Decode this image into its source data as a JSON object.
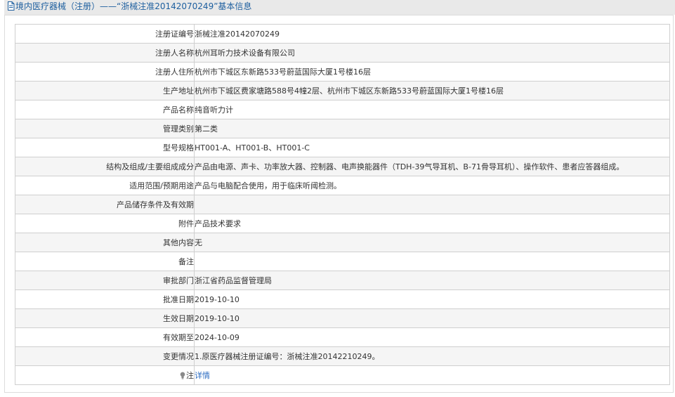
{
  "header": {
    "title": "境内医疗器械（注册）——“浙械注准20142070249”基本信息"
  },
  "rows": [
    {
      "label": "注册证编号",
      "value": "浙械注准20142070249"
    },
    {
      "label": "注册人名称",
      "value": "杭州耳听力技术设备有限公司"
    },
    {
      "label": "注册人住所",
      "value": "杭州市下城区东新路533号蔚蓝国际大厦1号楼16层"
    },
    {
      "label": "生产地址",
      "value": "杭州市下城区费家塘路588号4幢2层、杭州市下城区东新路533号蔚蓝国际大厦1号楼16层"
    },
    {
      "label": "产品名称",
      "value": "纯音听力计"
    },
    {
      "label": "管理类别",
      "value": "第二类"
    },
    {
      "label": "型号规格",
      "value": "HT001-A、HT001-B、HT001-C"
    },
    {
      "label": "结构及组成/主要组成成分",
      "value": "产品由电源、声卡、功率放大器、控制器、电声换能器件（TDH-39气导耳机、B-71骨导耳机）、操作软件、患者应答器组成。"
    },
    {
      "label": "适用范围/预期用途",
      "value": "产品与电脑配合使用，用于临床听阈检测。"
    },
    {
      "label": "产品储存条件及有效期",
      "value": ""
    },
    {
      "label": "附件",
      "value": "产品技术要求"
    },
    {
      "label": "其他内容",
      "value": "无"
    },
    {
      "label": "备注",
      "value": ""
    },
    {
      "label": "审批部门",
      "value": "浙江省药品监督管理局"
    },
    {
      "label": "批准日期",
      "value": "2019-10-10"
    },
    {
      "label": "生效日期",
      "value": "2019-10-10"
    },
    {
      "label": "有效期至",
      "value": "2024-10-09"
    },
    {
      "label": "变更情况",
      "value": "1.原医疗器械注册证编号：浙械注准20142210249。"
    }
  ],
  "note": {
    "label": "注",
    "link": "详情"
  },
  "colors": {
    "title": "#1e5f9f",
    "link": "#2a6bc1",
    "header_bg": "#e9e9e9",
    "row_alt": "#f5f5f5",
    "border": "#cfcfcf"
  },
  "icons": {
    "title": "document-icon",
    "note": "lightbulb-icon"
  }
}
